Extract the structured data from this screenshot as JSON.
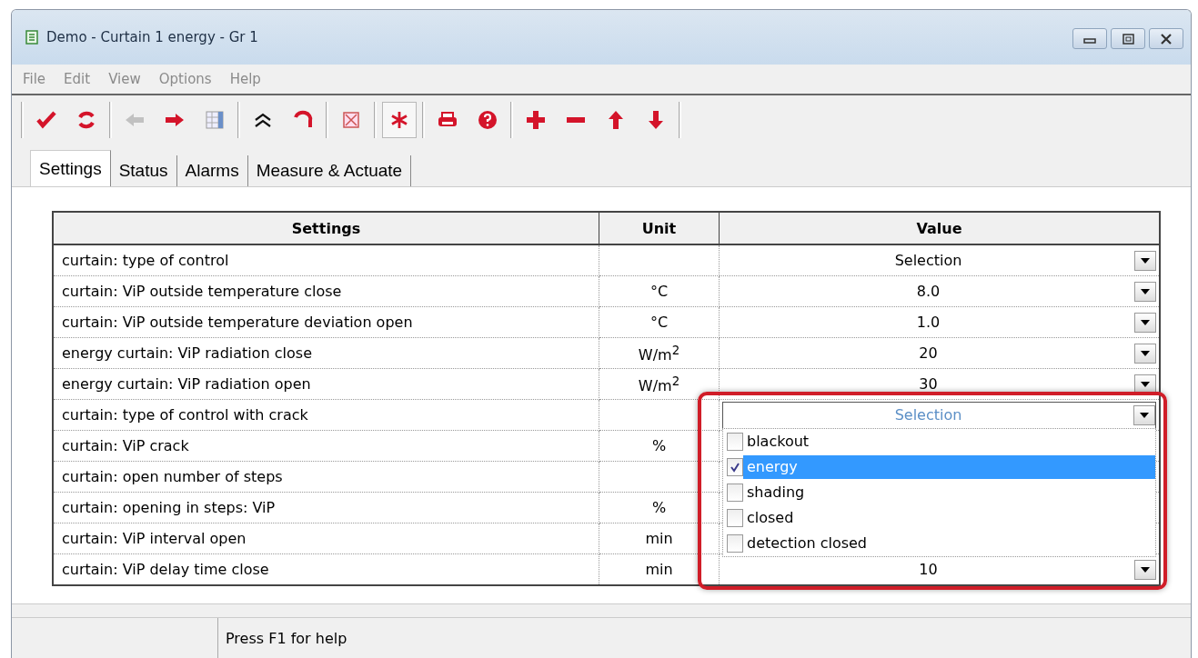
{
  "window": {
    "title": "Demo - Curtain 1 energy - Gr 1"
  },
  "menu": [
    "File",
    "Edit",
    "View",
    "Options",
    "Help"
  ],
  "toolbar": [
    {
      "items": [
        {
          "kind": "check",
          "disabled": false,
          "pressed": false
        },
        {
          "kind": "refresh",
          "disabled": false,
          "pressed": false
        }
      ]
    },
    {
      "items": [
        {
          "kind": "back",
          "disabled": true,
          "pressed": false
        },
        {
          "kind": "forward",
          "disabled": false,
          "pressed": false
        },
        {
          "kind": "grid",
          "disabled": false,
          "pressed": false
        }
      ]
    },
    {
      "items": [
        {
          "kind": "collapse",
          "disabled": false,
          "pressed": false
        },
        {
          "kind": "undo",
          "disabled": false,
          "pressed": false
        }
      ]
    },
    {
      "items": [
        {
          "kind": "clear",
          "disabled": false,
          "pressed": false
        }
      ]
    },
    {
      "items": [
        {
          "kind": "asterisk",
          "disabled": false,
          "pressed": true
        }
      ]
    },
    {
      "items": [
        {
          "kind": "print",
          "disabled": false,
          "pressed": false
        },
        {
          "kind": "help",
          "disabled": false,
          "pressed": false
        }
      ]
    },
    {
      "items": [
        {
          "kind": "add",
          "disabled": false,
          "pressed": false
        },
        {
          "kind": "remove",
          "disabled": false,
          "pressed": false
        },
        {
          "kind": "up",
          "disabled": false,
          "pressed": false
        },
        {
          "kind": "down",
          "disabled": false,
          "pressed": false
        }
      ]
    }
  ],
  "tabs": [
    {
      "label": "Settings",
      "selected": true
    },
    {
      "label": "Status",
      "selected": false
    },
    {
      "label": "Alarms",
      "selected": false
    },
    {
      "label": "Measure & Actuate",
      "selected": false
    }
  ],
  "table": {
    "columns": [
      "Settings",
      "Unit",
      "Value"
    ],
    "rows": [
      {
        "setting": "curtain: type of control",
        "value": "Selection"
      },
      {
        "setting": "curtain: ViP outside temperature close",
        "unit": "°C",
        "value": "8.0"
      },
      {
        "setting": "curtain: ViP outside temperature deviation open",
        "unit": "°C",
        "value": "1.0"
      },
      {
        "setting": "energy curtain: ViP radiation close",
        "unit": "W/m$^{2}$",
        "value": "20"
      },
      {
        "setting": "energy curtain: ViP radiation open",
        "unit": "W/m$^{2}$",
        "value": "30"
      },
      {
        "setting": "curtain: type of control with crack",
        "value": "Selection",
        "dropdown_options": [
          {
            "label": "blackout",
            "checked": false,
            "selected": false
          },
          {
            "label": "energy",
            "checked": true,
            "selected": true
          },
          {
            "label": "shading",
            "checked": false,
            "selected": false
          },
          {
            "label": "closed",
            "checked": false,
            "selected": false
          },
          {
            "label": "detection closed",
            "checked": false,
            "selected": false
          }
        ]
      },
      {
        "setting": "curtain: ViP crack",
        "unit": "%"
      },
      {
        "setting": "curtain: open number of steps"
      },
      {
        "setting": "curtain: opening in steps: ViP",
        "unit": "%"
      },
      {
        "setting": "curtain: ViP interval open",
        "unit": "min"
      },
      {
        "setting": "curtain: ViP delay time close",
        "unit": "min",
        "value": "10"
      }
    ]
  },
  "status_bar": "Press F1 for help"
}
